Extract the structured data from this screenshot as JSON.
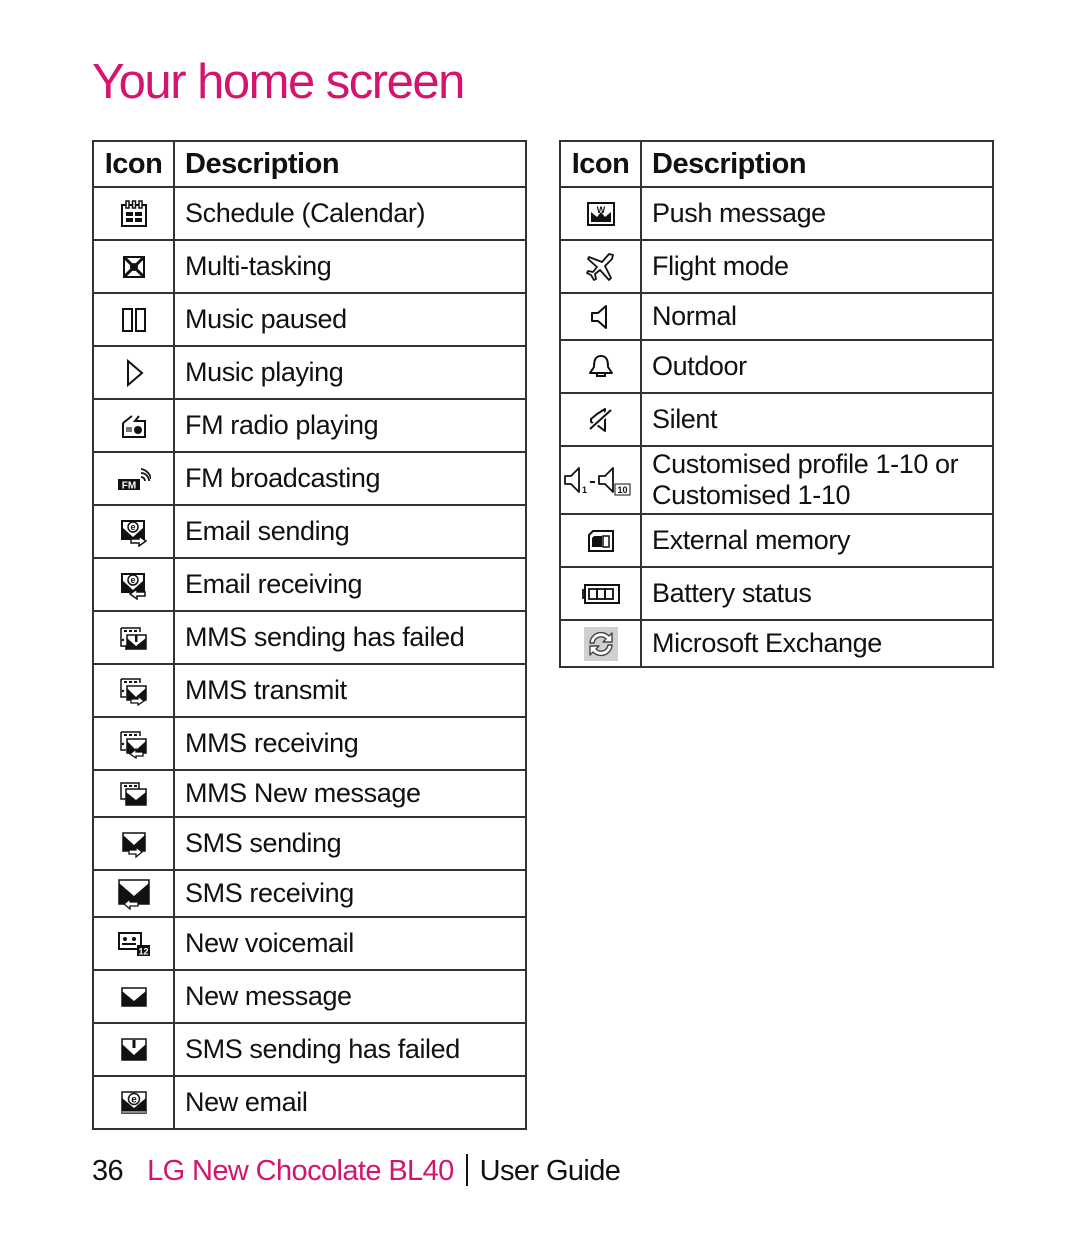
{
  "page": {
    "title": "Your home screen",
    "accent_color": "#d4146f"
  },
  "left_table": {
    "headers": {
      "icon": "Icon",
      "description": "Description"
    },
    "rows": [
      {
        "icon": "calendar-icon",
        "description": "Schedule (Calendar)"
      },
      {
        "icon": "multitasking-icon",
        "description": "Multi-tasking"
      },
      {
        "icon": "pause-icon",
        "description": "Music paused"
      },
      {
        "icon": "play-icon",
        "description": "Music playing"
      },
      {
        "icon": "radio-icon",
        "description": "FM radio playing"
      },
      {
        "icon": "fm-broadcast-icon",
        "description": "FM broadcasting"
      },
      {
        "icon": "email-send-icon",
        "description": "Email sending"
      },
      {
        "icon": "email-receive-icon",
        "description": "Email receiving"
      },
      {
        "icon": "mms-failed-icon",
        "description": "MMS sending has failed"
      },
      {
        "icon": "mms-transmit-icon",
        "description": "MMS transmit"
      },
      {
        "icon": "mms-receive-icon",
        "description": "MMS receiving"
      },
      {
        "icon": "mms-new-icon",
        "description": "MMS New message"
      },
      {
        "icon": "sms-send-icon",
        "description": "SMS sending"
      },
      {
        "icon": "sms-receive-icon",
        "description": "SMS receiving"
      },
      {
        "icon": "voicemail-icon",
        "description": "New voicemail"
      },
      {
        "icon": "new-message-icon",
        "description": "New message"
      },
      {
        "icon": "sms-failed-icon",
        "description": "SMS sending has failed"
      },
      {
        "icon": "new-email-icon",
        "description": "New email"
      }
    ]
  },
  "right_table": {
    "headers": {
      "icon": "Icon",
      "description": "Description"
    },
    "rows": [
      {
        "icon": "push-message-icon",
        "description": "Push message"
      },
      {
        "icon": "airplane-icon",
        "description": "Flight mode"
      },
      {
        "icon": "speaker-icon",
        "description": "Normal"
      },
      {
        "icon": "bell-icon",
        "description": "Outdoor"
      },
      {
        "icon": "speaker-muted-icon",
        "description": "Silent"
      },
      {
        "icon": "custom-profile-icon",
        "description": "Customised profile 1-10 or Customised 1-10",
        "icon_text_1": "1",
        "icon_text_2": "10"
      },
      {
        "icon": "memory-card-icon",
        "description": "External memory"
      },
      {
        "icon": "battery-icon",
        "description": "Battery status"
      },
      {
        "icon": "sync-icon",
        "description": "Microsoft Exchange"
      }
    ]
  },
  "footer": {
    "page_number": "36",
    "product": "LG New Chocolate BL40",
    "guide": "User Guide"
  },
  "icon_labels": {
    "fm": "FM",
    "voicemail_count": "12",
    "email_letter": "e",
    "push_letter": "W"
  }
}
